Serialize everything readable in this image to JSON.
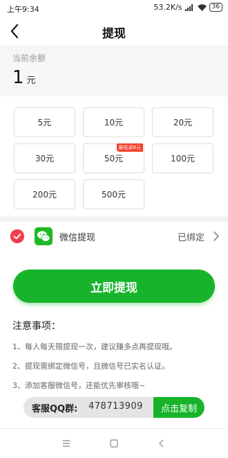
{
  "status_bar": {
    "time": "上午9:34",
    "network_speed": "53.2K/s",
    "battery": "36"
  },
  "nav": {
    "title": "提现"
  },
  "balance": {
    "label": "当前余额",
    "amount": "1",
    "unit": "元"
  },
  "amounts": [
    {
      "label": "5元"
    },
    {
      "label": "10元"
    },
    {
      "label": "20元"
    },
    {
      "label": "30元"
    },
    {
      "label": "50元",
      "badge": "最低返8元"
    },
    {
      "label": "100元"
    },
    {
      "label": "200元"
    },
    {
      "label": "500元"
    }
  ],
  "payment": {
    "method_label": "微信提现",
    "status": "已绑定"
  },
  "primary_button": {
    "label": "立即提现"
  },
  "notes": {
    "title": "注意事项：",
    "items": [
      "1、每人每天限提现一次，建议赚多点再提现哦。",
      "2、提现需绑定微信号，且微信号已实名认证。",
      "3、添加客服微信号，还能优先审核哦~"
    ]
  },
  "customer_service": {
    "label": "客服QQ群:",
    "number": "478713909",
    "copy_label": "点击复制"
  },
  "colors": {
    "accent_green": "#17b42b",
    "check_red": "#f23d4a",
    "badge_red": "#f43f2a"
  }
}
